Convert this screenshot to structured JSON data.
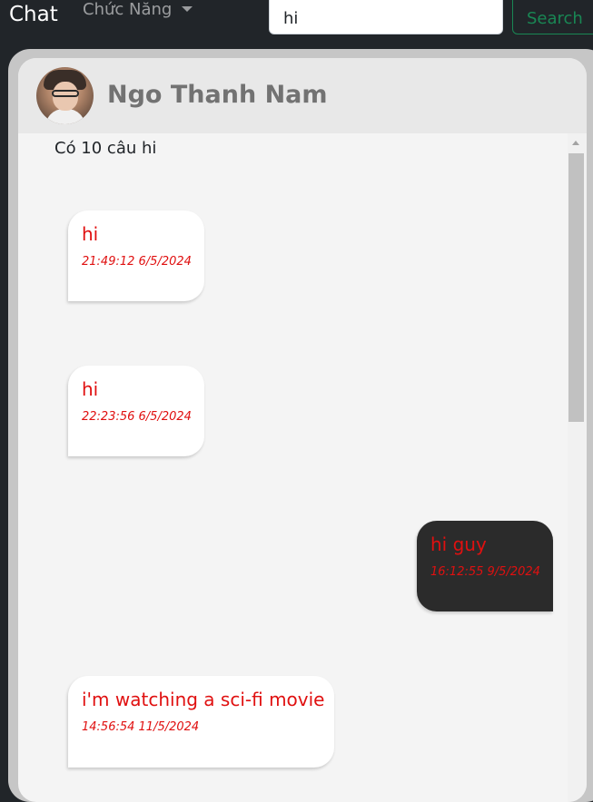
{
  "navbar": {
    "brand": "Chat",
    "menu_label": "Chức Năng",
    "search_value": "hi",
    "search_button": "Search"
  },
  "chat": {
    "contact_name": "Ngo Thanh Nam",
    "result_summary": "Có 10 câu hi",
    "messages": [
      {
        "direction": "received",
        "text": "hi",
        "time": "21:49:12 6/5/2024"
      },
      {
        "direction": "received",
        "text": "hi",
        "time": "22:23:56 6/5/2024"
      },
      {
        "direction": "sent",
        "text": "hi guy",
        "time": "16:12:55 9/5/2024"
      },
      {
        "direction": "received",
        "text": "i'm watching a sci-fi movie",
        "time": "14:56:54 11/5/2024"
      }
    ]
  },
  "colors": {
    "navbar_bg": "#212529",
    "message_text": "#e01010",
    "sent_bubble": "#2b2b2b",
    "received_bubble": "#ffffff",
    "search_accent": "#198754"
  }
}
